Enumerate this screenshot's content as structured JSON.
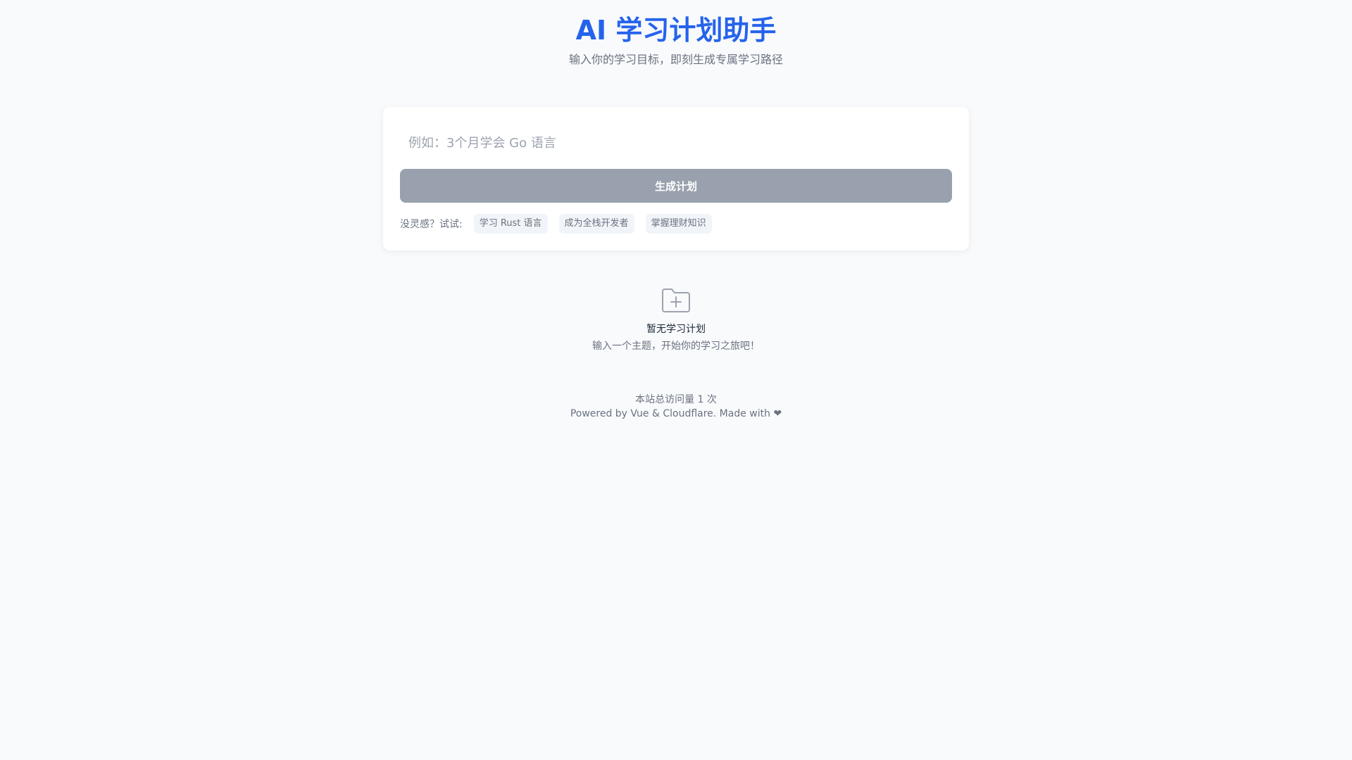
{
  "header": {
    "title": "AI 学习计划助手",
    "subtitle": "输入你的学习目标，即刻生成专属学习路径"
  },
  "form": {
    "input_placeholder": "例如：3个月学会 Go 语言",
    "input_value": "",
    "generate_label": "生成计划",
    "generate_color": "#98a1ad"
  },
  "suggestions": {
    "label": "没灵感？试试:",
    "items": [
      {
        "label": "学习 Rust 语言"
      },
      {
        "label": "成为全栈开发者"
      },
      {
        "label": "掌握理财知识"
      }
    ]
  },
  "empty_state": {
    "icon": "folder-plus-icon",
    "title": "暂无学习计划",
    "description": "输入一个主题，开始你的学习之旅吧！"
  },
  "footer": {
    "visits_text": "本站总访问量 1 次",
    "powered_text": "Powered by Vue & Cloudflare. Made with ❤"
  },
  "colors": {
    "accent": "#2563eb",
    "background": "#f8fafc"
  }
}
